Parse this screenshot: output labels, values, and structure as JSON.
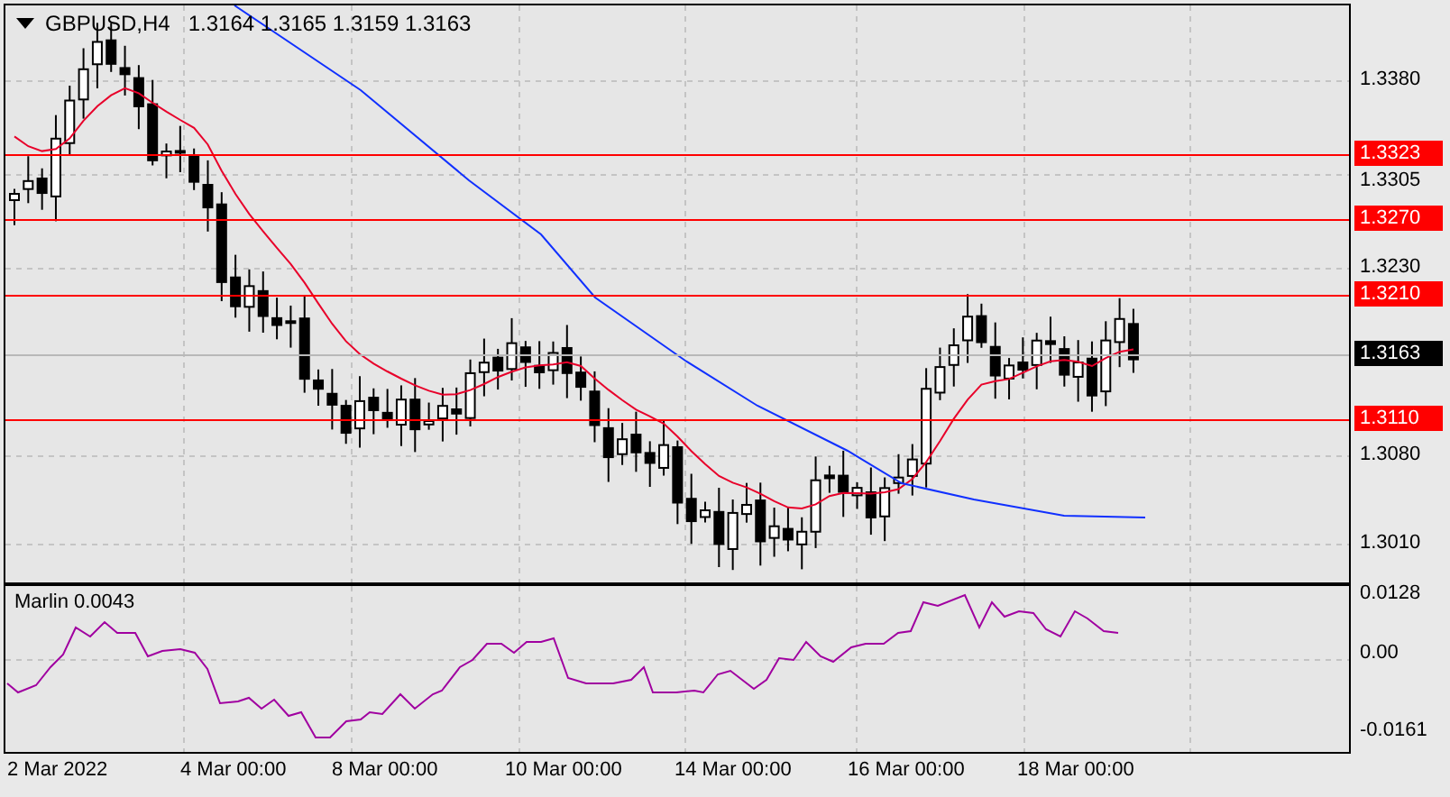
{
  "chart": {
    "symbol": "GBPUSD,H4",
    "ohlc": "1.3164 1.3165 1.3159 1.3163",
    "price_ticks": [
      "1.3380",
      "1.3305",
      "1.3230",
      "1.3080",
      "1.3010"
    ],
    "markers": [
      {
        "label": "1.3323",
        "kind": "level"
      },
      {
        "label": "1.3270",
        "kind": "level"
      },
      {
        "label": "1.3210",
        "kind": "level"
      },
      {
        "label": "1.3163",
        "kind": "price"
      },
      {
        "label": "1.3110",
        "kind": "level"
      }
    ]
  },
  "indicator": {
    "title": "Marlin 0.0043",
    "ticks": [
      "0.0128",
      "0.00",
      "-0.0161"
    ]
  },
  "time_axis": [
    "2 Mar 2022",
    "4 Mar 00:00",
    "8 Mar 00:00",
    "10 Mar 00:00",
    "14 Mar 00:00",
    "16 Mar 00:00",
    "18 Mar 00:00"
  ]
}
